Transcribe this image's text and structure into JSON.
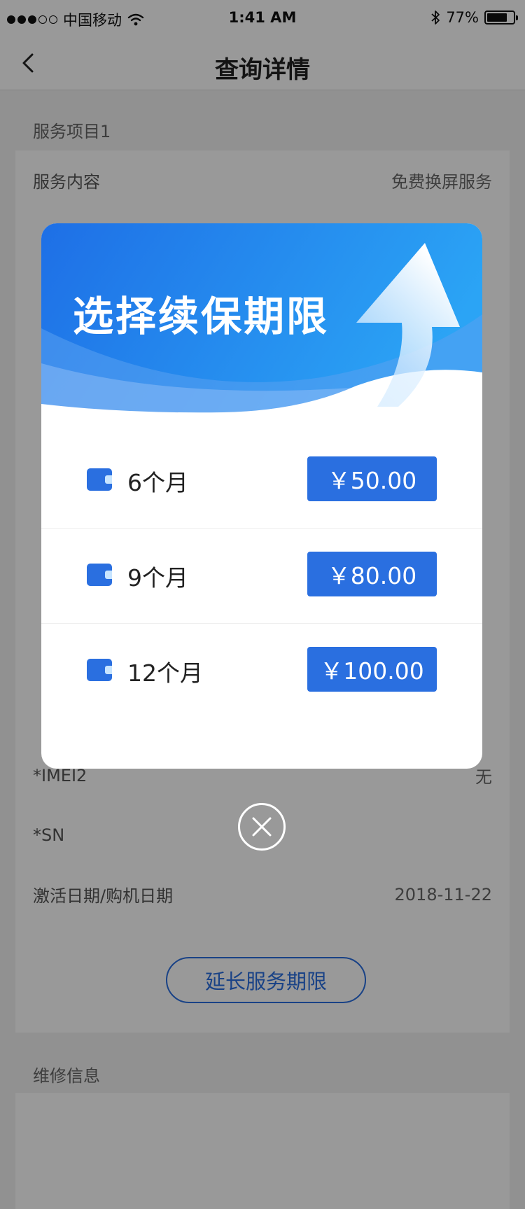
{
  "status_bar": {
    "carrier": "中国移动",
    "time": "1:41 AM",
    "battery_percent": "77%",
    "battery_level": 0.77,
    "signal_dots_filled": 3,
    "signal_dots_total": 5
  },
  "nav": {
    "title": "查询详情"
  },
  "service": {
    "section_title": "服务项目1",
    "rows": [
      {
        "label": "服务内容",
        "value": "免费换屏服务"
      },
      {
        "label": "",
        "value": ""
      },
      {
        "label": "",
        "value": ""
      },
      {
        "label": "",
        "value": ""
      },
      {
        "label": "",
        "value": ""
      },
      {
        "label": "",
        "value": ""
      },
      {
        "label": "",
        "value": ""
      },
      {
        "label": "",
        "value": ""
      },
      {
        "label": "",
        "value": ""
      },
      {
        "label": "",
        "value": ""
      },
      {
        "label": "*IMEI2",
        "value": "无"
      },
      {
        "label": "*SN",
        "value": ""
      },
      {
        "label": "激活日期/购机日期",
        "value": "2018-11-22"
      }
    ],
    "extend_button": "延长服务期限"
  },
  "repair": {
    "section_title": "维修信息"
  },
  "modal": {
    "title": "选择续保期限",
    "options": [
      {
        "label": "6个月",
        "price": "￥50.00"
      },
      {
        "label": "9个月",
        "price": "￥80.00"
      },
      {
        "label": "12个月",
        "price": "￥100.00"
      }
    ]
  },
  "colors": {
    "accent": "#2a6fe0",
    "hero_light": "#2ba4f5",
    "hero_dark": "#1e6fe6"
  }
}
